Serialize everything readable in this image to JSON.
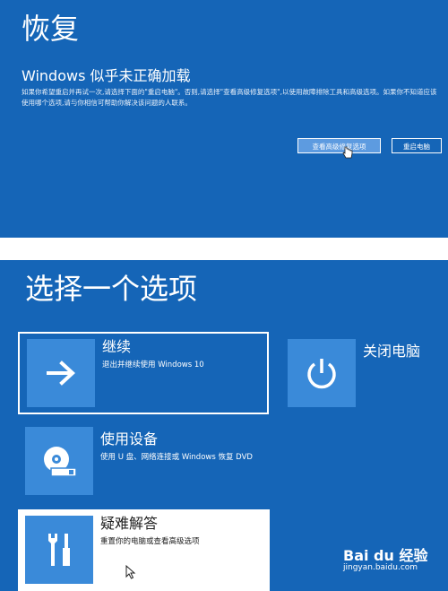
{
  "recovery": {
    "title": "恢复",
    "subtitle": "Windows 似乎未正确加载",
    "description": "如果你希望重启并再试一次,请选择下面的\"重启电脑\"。否则,请选择\"查看高级修复选项\",以使用故障排除工具和高级选项。如果你不知道应该使用哪个选项,请与你相信可帮助你解决该问题的人联系。",
    "advanced_button": "查看高级修复选项",
    "restart_button": "重启电脑"
  },
  "choose": {
    "title": "选择一个选项",
    "options": [
      {
        "title": "继续",
        "desc": "退出并继续使用 Windows 10",
        "icon": "arrow-right-icon"
      },
      {
        "title": "关闭电脑",
        "desc": "",
        "icon": "power-icon"
      },
      {
        "title": "使用设备",
        "desc": "使用 U 盘、网络连接或 Windows 恢复 DVD",
        "icon": "disc-drive-icon"
      },
      {
        "title": "疑难解答",
        "desc": "重置你的电脑或查看高级选项",
        "icon": "tools-icon"
      }
    ]
  },
  "watermark": {
    "logo": "Bai du 经验",
    "url": "jingyan.baidu.com"
  },
  "colors": {
    "background": "#1565b7",
    "tile": "#3a8ad9",
    "highlight": "#ffffff"
  }
}
